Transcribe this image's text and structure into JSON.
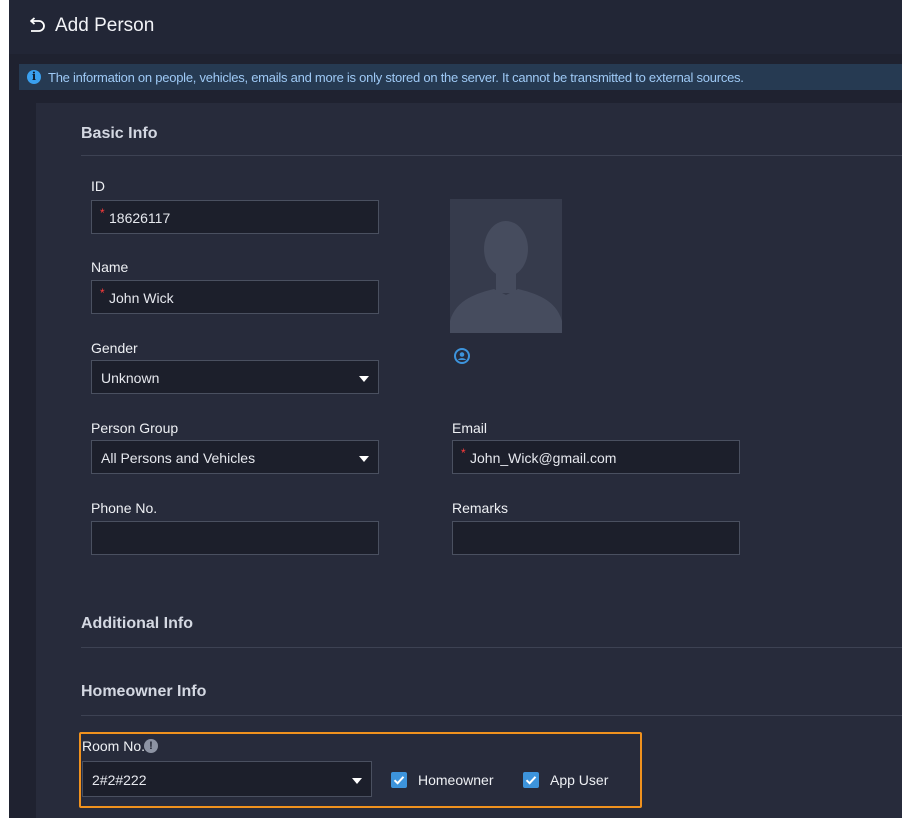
{
  "header": {
    "title": "Add Person",
    "back_icon": "undo-arrow-icon"
  },
  "notice": {
    "icon": "info-icon",
    "text": "The information on people, vehicles, emails and more is only stored on the server. It cannot be transmitted to external sources."
  },
  "basic_info": {
    "title": "Basic Info",
    "id": {
      "label": "ID",
      "value": "18626117",
      "required": "*"
    },
    "name": {
      "label": "Name",
      "value": "John Wick",
      "required": "*"
    },
    "gender": {
      "label": "Gender",
      "value": "Unknown"
    },
    "person_group": {
      "label": "Person Group",
      "value": "All Persons and Vehicles"
    },
    "email": {
      "label": "Email",
      "value": "John_Wick@gmail.com",
      "required": "*"
    },
    "phone": {
      "label": "Phone No.",
      "value": ""
    },
    "remarks": {
      "label": "Remarks",
      "value": ""
    }
  },
  "additional_info": {
    "title": "Additional Info"
  },
  "homeowner_info": {
    "title": "Homeowner Info",
    "room": {
      "label": "Room No.",
      "value": "2#2#222"
    },
    "homeowner": {
      "label": "Homeowner",
      "checked": true
    },
    "app_user": {
      "label": "App User",
      "checked": true
    }
  },
  "colors": {
    "accent": "#3d94dc",
    "highlight_border": "#f0921e",
    "required": "#ff3b3b"
  }
}
